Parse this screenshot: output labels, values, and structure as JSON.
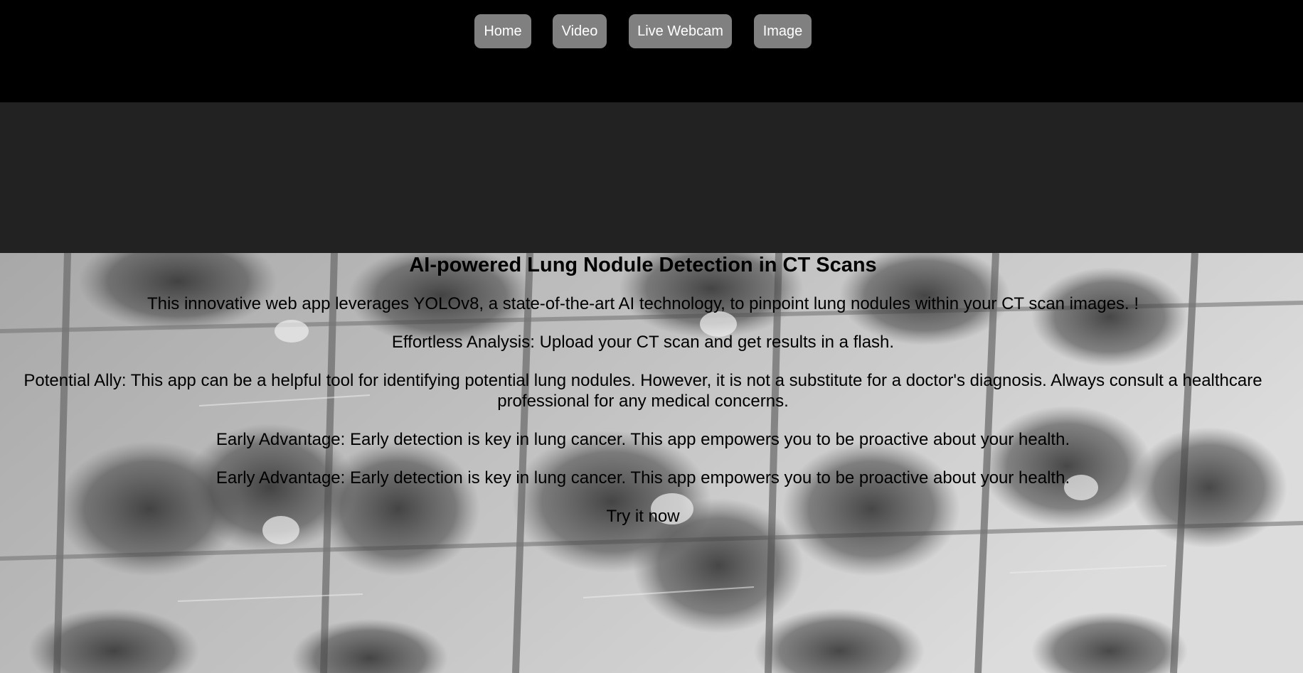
{
  "nav": {
    "items": [
      {
        "label": "Home"
      },
      {
        "label": "Video"
      },
      {
        "label": "Live Webcam"
      },
      {
        "label": "Image"
      }
    ]
  },
  "main": {
    "title": "AI-powered Lung Nodule Detection in CT Scans",
    "paragraphs": [
      "This innovative web app leverages YOLOv8, a state-of-the-art AI technology, to pinpoint lung nodules within your CT scan images. !",
      "Effortless Analysis: Upload your CT scan and get results in a flash.",
      "Potential Ally: This app can be a helpful tool for identifying potential lung nodules. However, it is not a substitute for a doctor's diagnosis. Always consult a healthcare professional for any medical concerns.",
      "Early Advantage: Early detection is key in lung cancer. This app empowers you to be proactive about your health.",
      "Early Advantage: Early detection is key in lung cancer. This app empowers you to be proactive about your health."
    ],
    "cta": "Try it now"
  },
  "colors": {
    "topbar": "#000000",
    "band": "#222222",
    "nav_button": "#808080",
    "nav_text": "#ffffff",
    "hero_background": "#b9b9b9"
  }
}
